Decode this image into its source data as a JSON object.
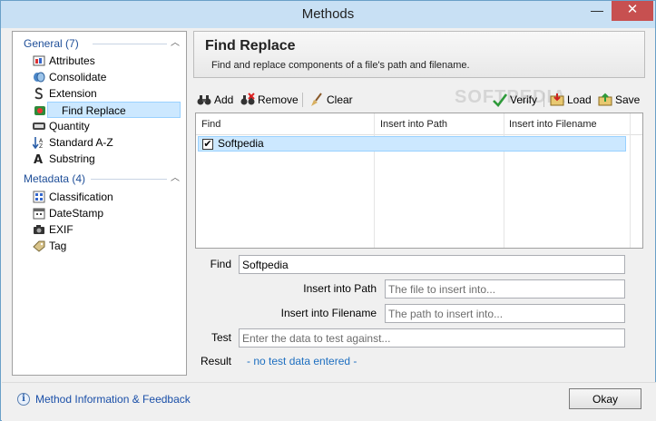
{
  "window": {
    "title": "Methods",
    "minimize": "—",
    "close": "✕"
  },
  "sidebar": {
    "groups": [
      {
        "label": "General (7)",
        "items": [
          {
            "label": "Attributes",
            "icon": "attributes-icon"
          },
          {
            "label": "Consolidate",
            "icon": "consolidate-icon"
          },
          {
            "label": "Extension",
            "icon": "extension-icon"
          },
          {
            "label": "Find Replace",
            "icon": "find-replace-icon"
          },
          {
            "label": "Quantity",
            "icon": "quantity-icon"
          },
          {
            "label": "Standard A-Z",
            "icon": "sort-az-icon"
          },
          {
            "label": "Substring",
            "icon": "substring-icon"
          }
        ]
      },
      {
        "label": "Metadata (4)",
        "items": [
          {
            "label": "Classification",
            "icon": "classification-icon"
          },
          {
            "label": "DateStamp",
            "icon": "datestamp-icon"
          },
          {
            "label": "EXIF",
            "icon": "camera-icon"
          },
          {
            "label": "Tag",
            "icon": "tag-icon"
          }
        ]
      }
    ],
    "selected": "Find Replace"
  },
  "panel": {
    "title": "Find Replace",
    "subtitle": "Find and replace components of a file's path and filename."
  },
  "toolbar": {
    "add": "Add",
    "remove": "Remove",
    "clear": "Clear",
    "verify": "Verify",
    "load": "Load",
    "save": "Save"
  },
  "watermark": "SOFTPEDIA",
  "grid": {
    "columns": [
      "Find",
      "Insert into Path",
      "Insert into Filename"
    ],
    "rows": [
      {
        "checked": true,
        "find": "Softpedia",
        "path": "",
        "filename": ""
      }
    ]
  },
  "form": {
    "find_label": "Find",
    "find_value": "Softpedia",
    "path_label": "Insert into Path",
    "path_placeholder": "The file to insert into...",
    "filename_label": "Insert into Filename",
    "filename_placeholder": "The path to insert into...",
    "test_label": "Test",
    "test_placeholder": "Enter the data to test against...",
    "result_label": "Result",
    "result_value": "- no test data entered -"
  },
  "footer": {
    "info_icon_glyph": "i",
    "info_link": "Method Information & Feedback",
    "ok": "Okay"
  },
  "colors": {
    "titlebar": "#c8e0f4",
    "close": "#c75050",
    "selection": "#cce8ff",
    "link": "#1a4fa8",
    "group_header": "#1e4e98"
  }
}
